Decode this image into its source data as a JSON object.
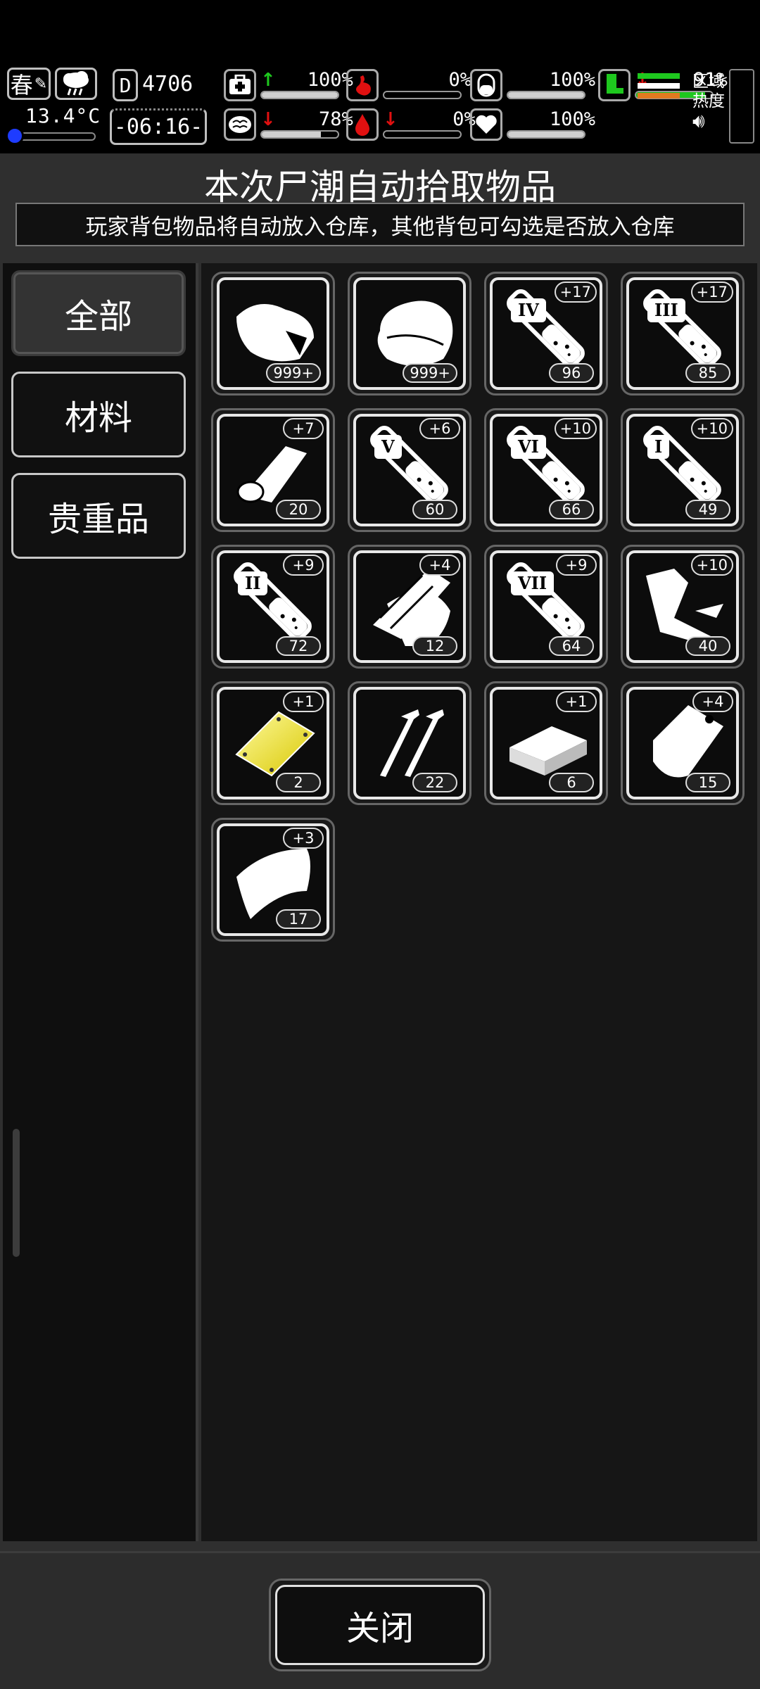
{
  "hud": {
    "season": "春",
    "temperature": "13.4°C",
    "day_prefix": "D",
    "day_count": "4706",
    "time": "-06:16-",
    "zone_heat_label_1": "区域",
    "zone_heat_label_2": "热度",
    "stats": [
      {
        "icon": "medkit-icon",
        "trend": "up",
        "value": "100%",
        "fill": 1.0
      },
      {
        "icon": "stomach-icon",
        "trend": "none",
        "value": "0%",
        "fill": 0.0
      },
      {
        "icon": "pill-icon",
        "trend": "none",
        "value": "100%",
        "fill": 1.0
      },
      {
        "icon": "brain-icon",
        "trend": "down",
        "value": "78%",
        "fill": 0.78
      },
      {
        "icon": "blood-drop-icon",
        "trend": "down",
        "value": "0%",
        "fill": 0.0
      },
      {
        "icon": "heart-icon",
        "trend": "none",
        "value": "100%",
        "fill": 1.0
      },
      {
        "icon": "boot-icon",
        "trend": "down",
        "value": "91%",
        "fill": 0.91
      }
    ],
    "colors": {
      "accent_green": "#1ec81e",
      "danger_red": "#e01010",
      "temp_blue": "#1e3cff",
      "stamina_orange": "#e07a20"
    }
  },
  "panel": {
    "title": "本次尸潮自动拾取物品",
    "subtitle": "玩家背包物品将自动放入仓库，其他背包可勾选是否放入仓库"
  },
  "sidebar": {
    "tabs": [
      {
        "label": "全部",
        "active": true
      },
      {
        "label": "材料",
        "active": false
      },
      {
        "label": "贵重品",
        "active": false
      }
    ]
  },
  "items": [
    {
      "name": "meat-icon",
      "count": "999+",
      "plus": ""
    },
    {
      "name": "cloth-icon",
      "count": "999+",
      "plus": ""
    },
    {
      "name": "syringe-iv-icon",
      "grade": "IV",
      "count": "96",
      "plus": "+17"
    },
    {
      "name": "syringe-iii-icon",
      "grade": "III",
      "count": "85",
      "plus": "+17"
    },
    {
      "name": "bandage-roll-icon",
      "count": "20",
      "plus": "+7"
    },
    {
      "name": "syringe-v-icon",
      "grade": "V",
      "count": "60",
      "plus": "+6"
    },
    {
      "name": "syringe-vi-icon",
      "grade": "VI",
      "count": "66",
      "plus": "+10"
    },
    {
      "name": "syringe-i-icon",
      "grade": "I",
      "count": "49",
      "plus": "+10"
    },
    {
      "name": "syringe-ii-icon",
      "grade": "II",
      "count": "72",
      "plus": "+9"
    },
    {
      "name": "wood-planks-icon",
      "count": "12",
      "plus": "+4"
    },
    {
      "name": "syringe-vii-icon",
      "grade": "VII",
      "count": "64",
      "plus": "+9"
    },
    {
      "name": "pipe-scrap-icon",
      "count": "40",
      "plus": "+10"
    },
    {
      "name": "gold-plate-icon",
      "count": "2",
      "plus": "+1"
    },
    {
      "name": "nails-icon",
      "count": "22",
      "plus": ""
    },
    {
      "name": "brick-icon",
      "count": "6",
      "plus": "+1"
    },
    {
      "name": "plastic-bag-icon",
      "count": "15",
      "plus": "+4"
    },
    {
      "name": "leather-sheet-icon",
      "count": "17",
      "plus": "+3"
    }
  ],
  "footer": {
    "close_label": "关闭"
  }
}
